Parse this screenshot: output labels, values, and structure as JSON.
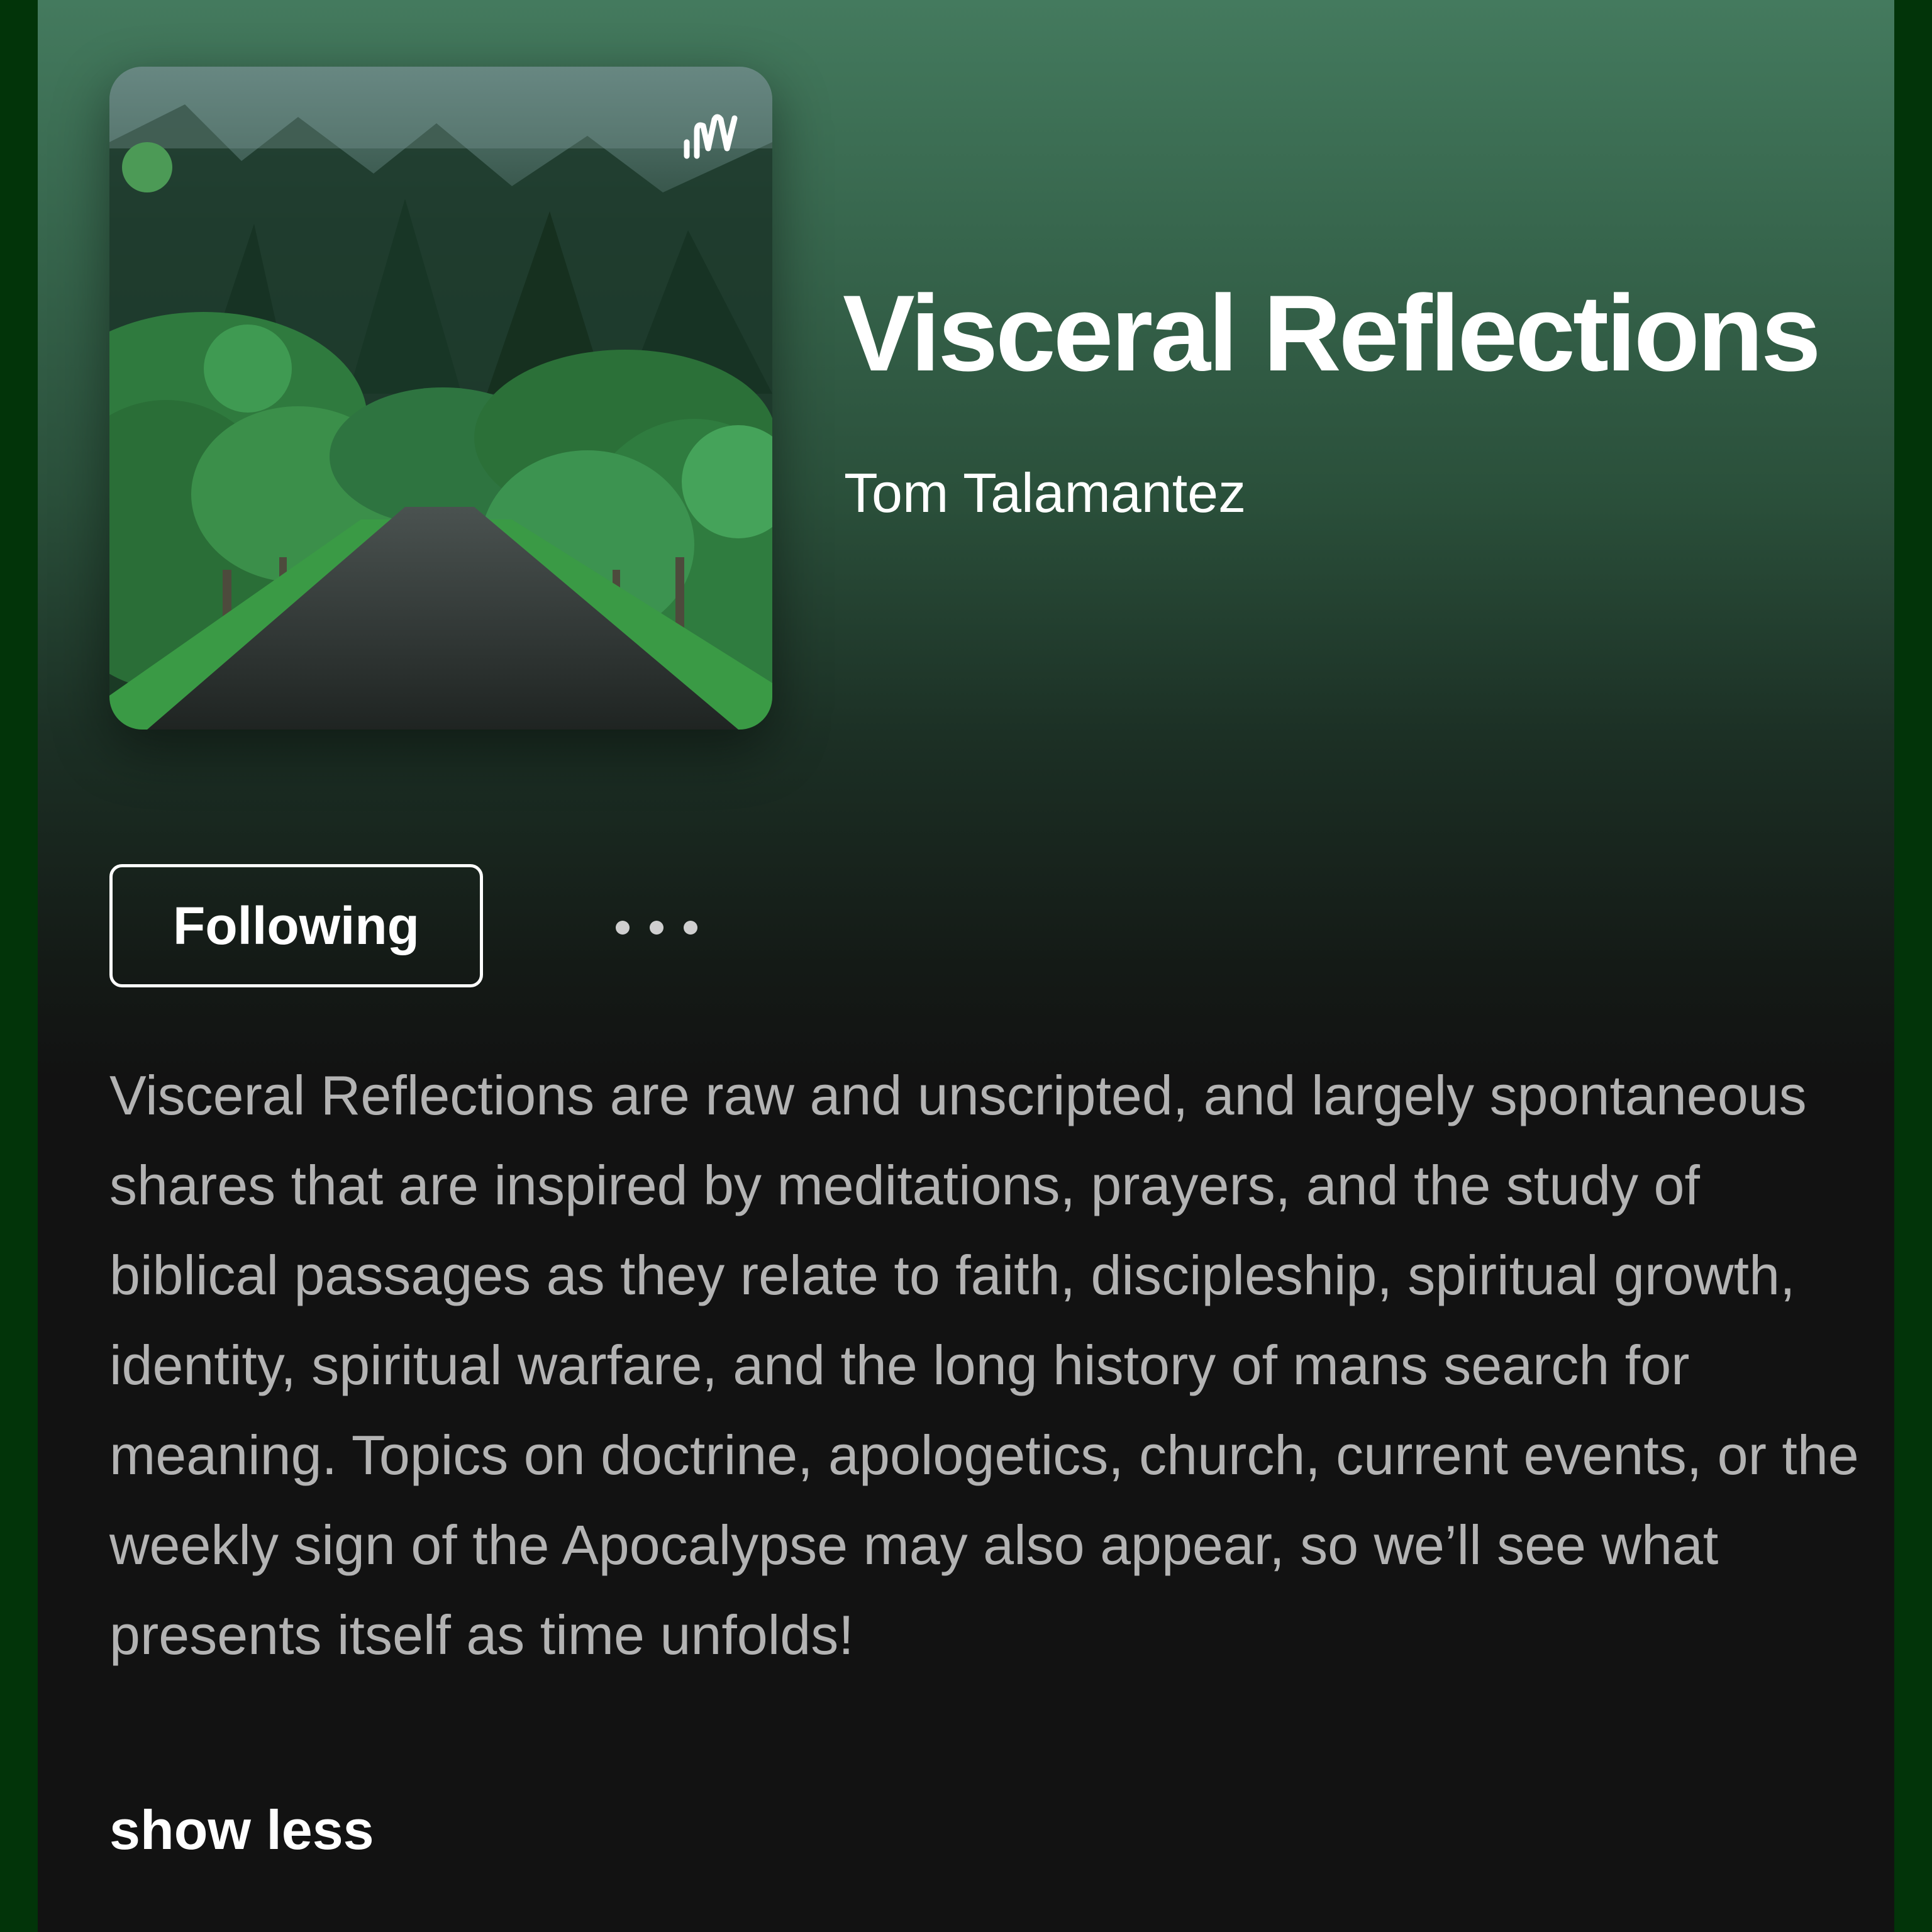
{
  "podcast": {
    "title": "Visceral Reflections",
    "author": "Tom Talamantez",
    "cover_icon": "anchor-logo-icon"
  },
  "actions": {
    "follow_label": "Following",
    "more_icon": "more-options-icon"
  },
  "description": {
    "text": "Visceral Reflections are raw and unscripted, and largely spontaneous shares that are inspired by meditations, prayers, and the study of biblical passages as they relate to faith, discipleship, spiritual growth, identity, spiritual warfare, and the long history of mans search for meaning. Topics on doctrine, apologetics, church, current events, or the weekly sign of the Apocalypse may also appear, so we’ll see what presents itself as time unfolds!",
    "toggle_label": "show less"
  },
  "colors": {
    "header_green": "#447a5e",
    "background": "#121212",
    "frame_green": "#023409",
    "text_primary": "#ffffff",
    "text_secondary": "#b3b3b3"
  }
}
